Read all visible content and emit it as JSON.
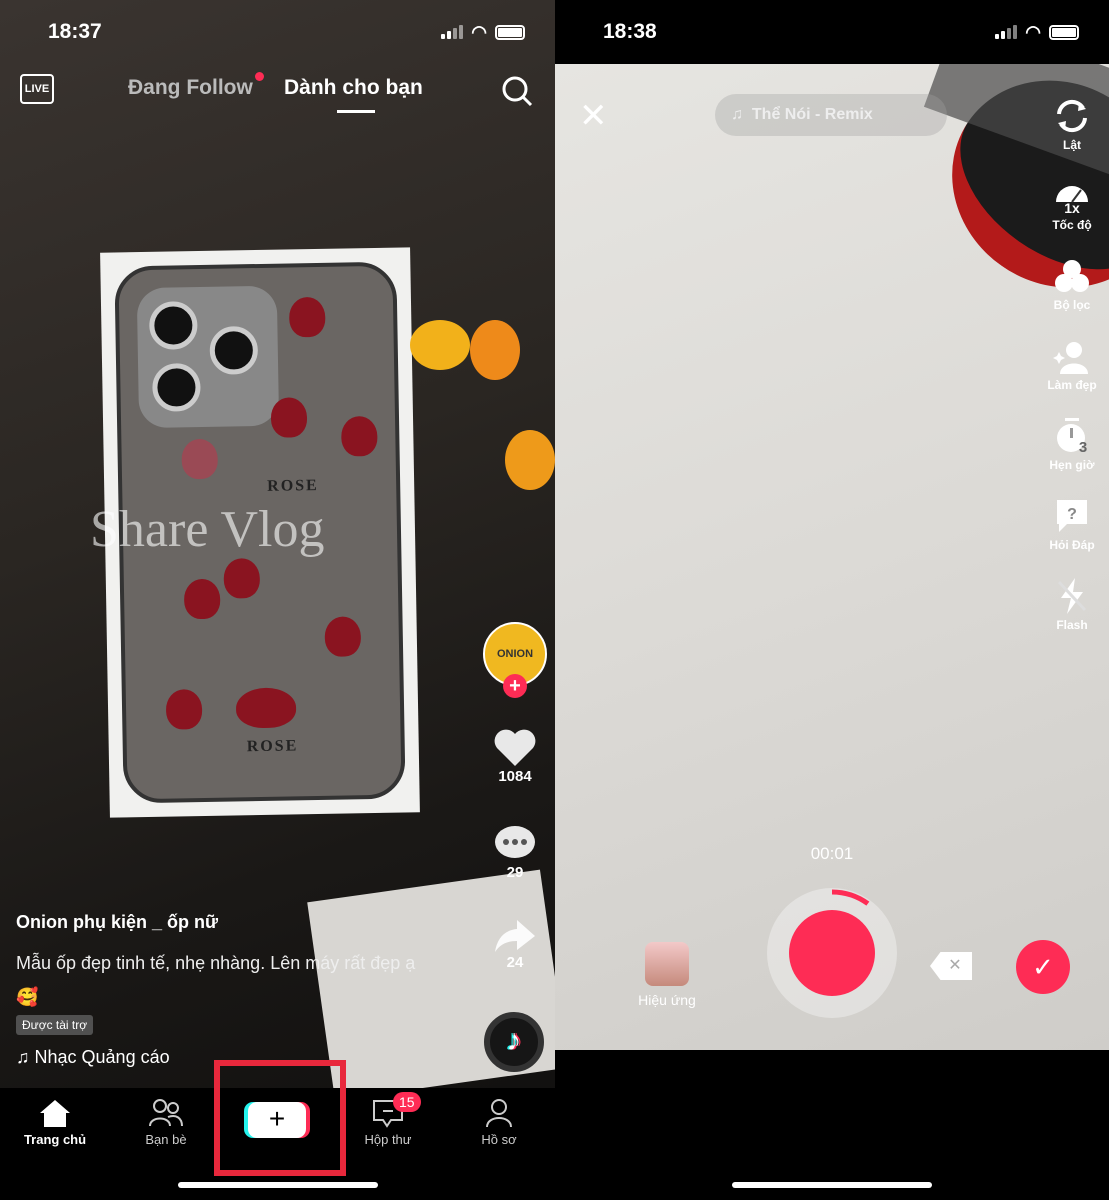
{
  "left": {
    "status": {
      "time": "18:37"
    },
    "top_tabs": {
      "live": "LIVE",
      "following": "Đang Follow",
      "for_you": "Dành cho bạn"
    },
    "video": {
      "overlay_text": "Share Vlog",
      "product_text": "ROSE"
    },
    "sidebar": {
      "avatar_label": "ONION",
      "likes": "1084",
      "comments": "29",
      "shares": "24"
    },
    "caption": {
      "author": "Onion phụ kiện _ ốp nữ",
      "text": "Mẫu ốp đẹp tinh tế, nhẹ nhàng. Lên máy rất đẹp ạ 🥰",
      "sponsored": "Được tài trợ",
      "music": "Nhạc Quảng cáo"
    },
    "nav": {
      "items": [
        {
          "label": "Trang chủ"
        },
        {
          "label": "Bạn bè"
        },
        {
          "label": "+"
        },
        {
          "label": "Hộp thư",
          "badge": "15"
        },
        {
          "label": "Hồ sơ"
        }
      ]
    },
    "highlight_color": "#e8283c"
  },
  "right": {
    "status": {
      "time": "18:38"
    },
    "music": "Thể Nói - Remix",
    "tools": [
      {
        "label": "Lật",
        "icon": "flip-camera-icon"
      },
      {
        "label": "Tốc độ",
        "icon": "speed-icon",
        "badge": "1x"
      },
      {
        "label": "Bộ lọc",
        "icon": "filter-icon"
      },
      {
        "label": "Làm đẹp",
        "icon": "beauty-icon"
      },
      {
        "label": "Hẹn giờ",
        "icon": "timer-icon",
        "badge": "3"
      },
      {
        "label": "Hỏi Đáp",
        "icon": "qa-icon"
      },
      {
        "label": "Flash",
        "icon": "flash-off-icon"
      }
    ],
    "timer": "00:01",
    "effects_label": "Hiệu ứng",
    "record_color": "#fe2c55",
    "record_progress_fraction": 0.1
  }
}
